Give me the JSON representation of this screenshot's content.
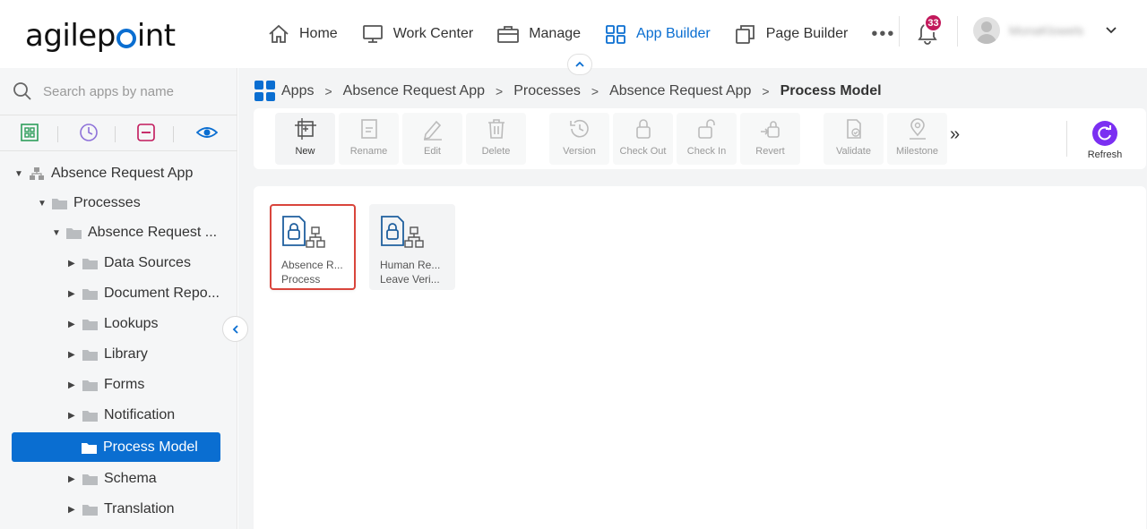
{
  "header": {
    "logo": "agilepoint",
    "nav": [
      {
        "label": "Home",
        "icon": "home-icon"
      },
      {
        "label": "Work Center",
        "icon": "monitor-icon"
      },
      {
        "label": "Manage",
        "icon": "briefcase-icon"
      },
      {
        "label": "App Builder",
        "icon": "grid-icon",
        "active": true
      },
      {
        "label": "Page Builder",
        "icon": "pages-icon"
      }
    ],
    "more": "•••",
    "notification_count": "33",
    "user_name": "MonaKlowels"
  },
  "sidebar": {
    "search_placeholder": "Search apps by name",
    "filters": [
      "apps-filter-icon",
      "clock-icon",
      "minus-box-icon",
      "eye-icon"
    ],
    "tree": {
      "root": "Absence Request App",
      "processes": "Processes",
      "app": "Absence Request ...",
      "children": [
        "Data Sources",
        "Document Repo...",
        "Lookups",
        "Library",
        "Forms",
        "Notification",
        "Process Model",
        "Schema",
        "Translation"
      ],
      "selected": "Process Model"
    }
  },
  "breadcrumb": [
    "Apps",
    "Absence Request App",
    "Processes",
    "Absence Request App",
    "Process Model"
  ],
  "toolbar": {
    "tools": [
      {
        "label": "New",
        "enabled": true
      },
      {
        "label": "Rename",
        "enabled": false
      },
      {
        "label": "Edit",
        "enabled": false
      },
      {
        "label": "Delete",
        "enabled": false
      },
      {
        "label": "Version",
        "enabled": false
      },
      {
        "label": "Check Out",
        "enabled": false
      },
      {
        "label": "Check In",
        "enabled": false
      },
      {
        "label": "Revert",
        "enabled": false
      },
      {
        "label": "Validate",
        "enabled": false
      },
      {
        "label": "Milestone",
        "enabled": false
      }
    ],
    "more": "»",
    "refresh": "Refresh"
  },
  "cards": [
    {
      "line1": "Absence R...",
      "line2": "Process",
      "highlighted": true
    },
    {
      "line1": "Human Re...",
      "line2": "Leave Veri...",
      "highlighted": false
    }
  ],
  "colors": {
    "accent": "#0a6ed1",
    "refresh": "#7b2ff2",
    "badge": "#c2185b",
    "highlight": "#d9453c"
  }
}
